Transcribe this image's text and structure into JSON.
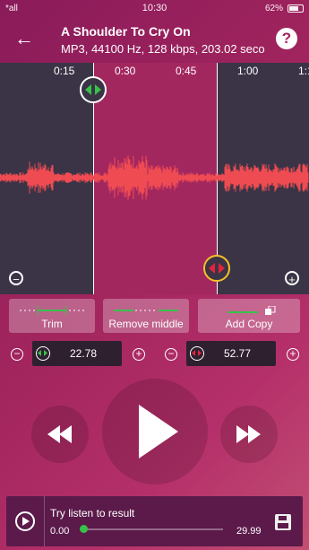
{
  "status_bar": {
    "carrier": "*all",
    "time": "10:30",
    "battery": "62%"
  },
  "header": {
    "title": "A Shoulder To Cry On",
    "subtitle": "MP3, 44100 Hz, 128 kbps, 203.02 seco…",
    "back_icon": "back-arrow-icon",
    "help_label": "?"
  },
  "timeline": {
    "ticks": [
      "0:15",
      "0:30",
      "0:45",
      "1:00",
      "1:1"
    ]
  },
  "actions": {
    "trim": "Trim",
    "remove_middle": "Remove middle",
    "add_copy": "Add Copy"
  },
  "start": {
    "value": "22.78"
  },
  "end": {
    "value": "52.77"
  },
  "result": {
    "label": "Try listen to result",
    "current": "0.00",
    "total": "29.99"
  },
  "colors": {
    "accent": "#37c24a",
    "marker_end": "#e0253b",
    "bg": "#a2255e"
  }
}
